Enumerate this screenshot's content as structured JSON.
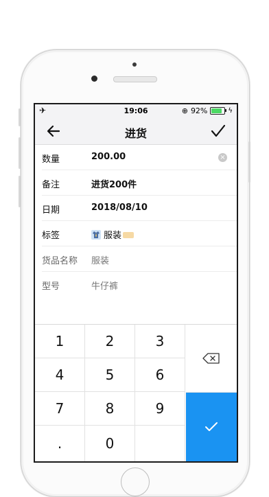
{
  "status_bar": {
    "time": "19:06",
    "battery_percent": "92%",
    "battery_level": 0.92
  },
  "nav": {
    "title": "进货"
  },
  "form": {
    "quantity_label": "数量",
    "quantity_value": "200.00",
    "note_label": "备注",
    "note_value": "进货200件",
    "date_label": "日期",
    "date_value": "2018/08/10",
    "tag_label": "标签",
    "tag_value": "服装",
    "product_name_label": "货品名称",
    "product_name_value": "服装",
    "model_label": "型号",
    "model_value": "牛仔裤"
  },
  "keypad": {
    "k1": "1",
    "k2": "2",
    "k3": "3",
    "k4": "4",
    "k5": "5",
    "k6": "6",
    "k7": "7",
    "k8": "8",
    "k9": "9",
    "kdot": ".",
    "k0": "0"
  },
  "colors": {
    "confirm_key": "#1a93f2",
    "battery": "#4cd964"
  }
}
